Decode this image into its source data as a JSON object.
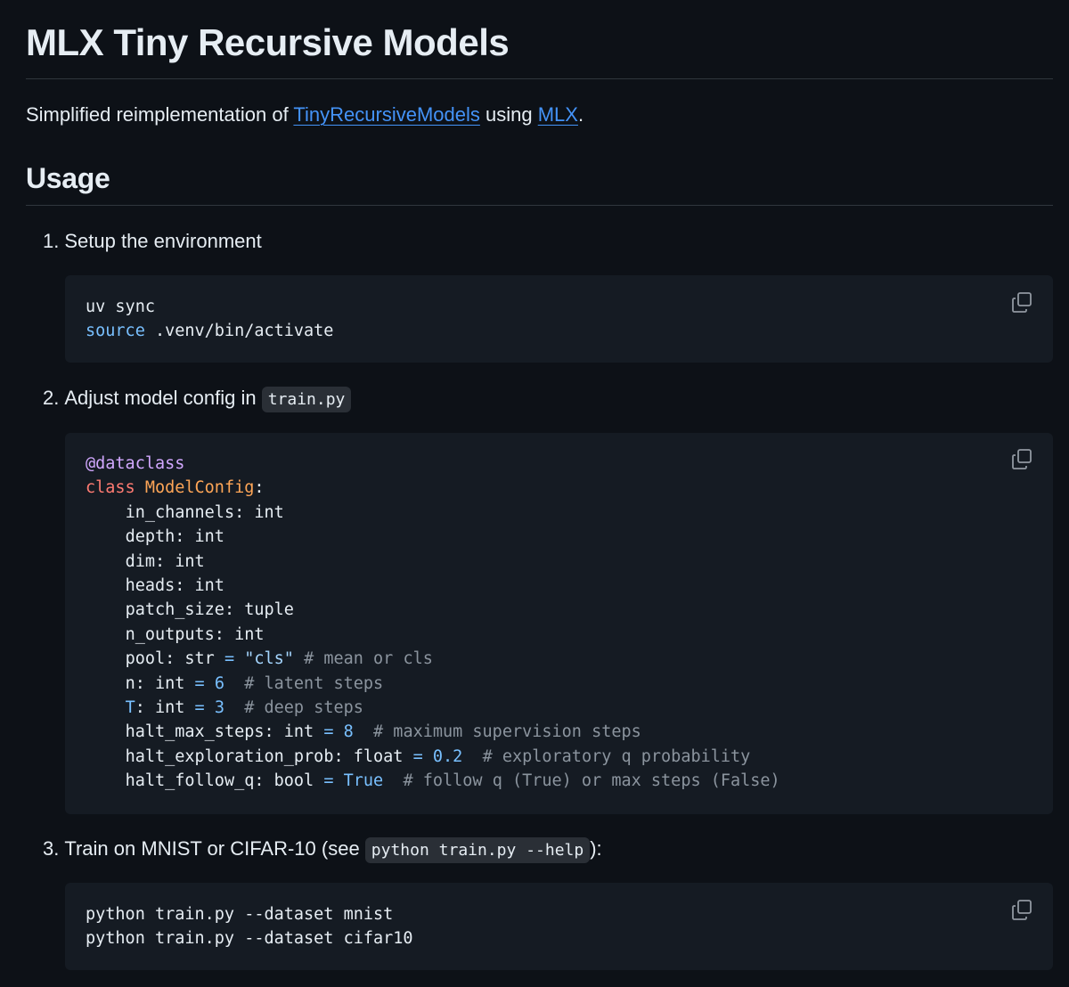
{
  "title": "MLX Tiny Recursive Models",
  "intro": {
    "before": "Simplified reimplementation of ",
    "link1": "TinyRecursiveModels",
    "middle": " using ",
    "link2": "MLX",
    "after": "."
  },
  "usage_heading": "Usage",
  "steps": [
    {
      "number": "1.",
      "text": "Setup the environment"
    },
    {
      "number": "2.",
      "text": "Adjust model config in ",
      "code": "train.py"
    },
    {
      "number": "3.",
      "text": "Train on MNIST or CIFAR-10 (see ",
      "code": "python train.py --help",
      "suffix": "):"
    }
  ],
  "code_blocks": {
    "setup": {
      "line1": "uv sync",
      "line2_kw": "source",
      "line2_rest": " .venv/bin/activate"
    },
    "config": {
      "decorator": "@dataclass",
      "class_kw": "class",
      "class_name": "ModelConfig",
      "class_colon": ":",
      "fields": [
        "in_channels: int",
        "depth: int",
        "dim: int",
        "heads: int",
        "patch_size: tuple",
        "n_outputs: int"
      ],
      "pool": {
        "name": "pool: str ",
        "eq": "=",
        "value": "\"cls\"",
        "comment": "# mean or cls"
      },
      "n": {
        "name": "n: int ",
        "eq": "=",
        "value": "6",
        "comment": "# latent steps"
      },
      "T": {
        "name": "T",
        "rest": ": int ",
        "eq": "=",
        "value": "3",
        "comment": "# deep steps"
      },
      "halt_max": {
        "name": "halt_max_steps: int ",
        "eq": "=",
        "value": "8",
        "comment": "# maximum supervision steps"
      },
      "halt_expl": {
        "name": "halt_exploration_prob: float ",
        "eq": "=",
        "value": "0.2",
        "comment": "# exploratory q probability"
      },
      "halt_follow": {
        "name": "halt_follow_q: bool ",
        "eq": "=",
        "value": "True",
        "comment": "# follow q (True) or max steps (False)"
      }
    },
    "train": {
      "line1": "python train.py --dataset mnist",
      "line2": "python train.py --dataset cifar10"
    }
  },
  "icons": {
    "copy": "copy-icon"
  },
  "colors": {
    "background": "#0d1117",
    "code_background": "#151b23",
    "link": "#4493f8",
    "keyword": "#ff7b72",
    "class_name": "#ffa657",
    "decorator": "#d2a8ff",
    "number": "#79c0ff",
    "string": "#a5d6ff",
    "comment": "#8b949e"
  }
}
